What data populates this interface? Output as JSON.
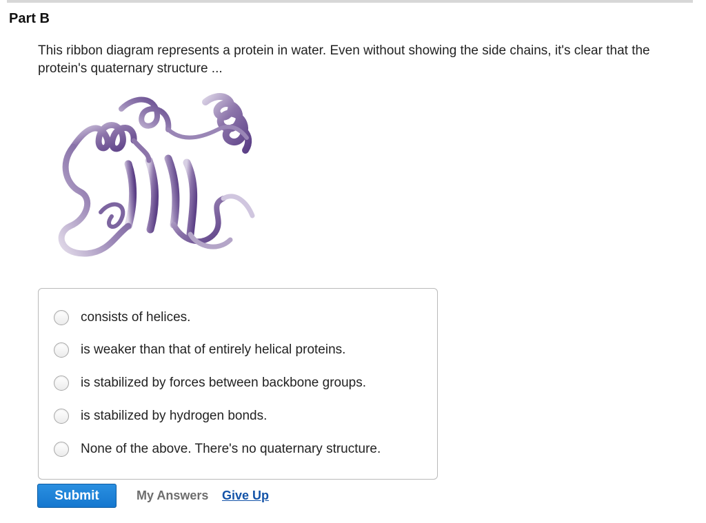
{
  "part": {
    "title": "Part B"
  },
  "question": {
    "text": "This ribbon diagram represents a protein in water. Even without showing the side chains, it's clear that the protein's quaternary structure ..."
  },
  "figure": {
    "icon": "protein-ribbon-diagram",
    "colors": {
      "ribbon_dark": "#5b3f86",
      "ribbon_mid": "#8c74aa",
      "ribbon_light": "#d8d0e4"
    }
  },
  "options": [
    {
      "label": "consists of helices.",
      "selected": false
    },
    {
      "label": "is weaker than that of entirely helical proteins.",
      "selected": false
    },
    {
      "label": "is stabilized by forces between backbone groups.",
      "selected": false
    },
    {
      "label": "is stabilized by hydrogen bonds.",
      "selected": false
    },
    {
      "label": "None of the above. There's no quaternary structure.",
      "selected": false
    }
  ],
  "actions": {
    "submit_label": "Submit",
    "my_answers_label": "My Answers",
    "give_up_label": "Give Up"
  },
  "colors": {
    "submit_blue": "#1577cf",
    "link_blue": "#1353a8",
    "muted_text": "#6d6d6d"
  }
}
